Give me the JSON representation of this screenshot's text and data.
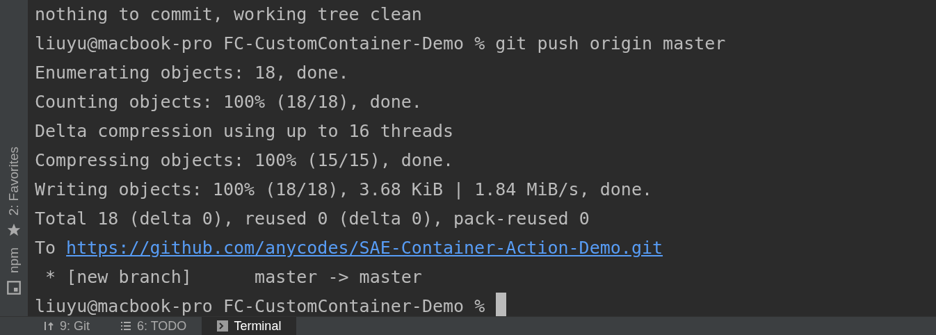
{
  "sidebar": {
    "items": [
      {
        "label": "2: Favorites",
        "kind": "star"
      },
      {
        "label": "npm",
        "kind": "square"
      }
    ]
  },
  "terminal": {
    "lines": [
      {
        "kind": "text",
        "text": "nothing to commit, working tree clean"
      },
      {
        "kind": "text",
        "text": "liuyu@macbook-pro FC-CustomContainer-Demo % git push origin master"
      },
      {
        "kind": "text",
        "text": "Enumerating objects: 18, done."
      },
      {
        "kind": "text",
        "text": "Counting objects: 100% (18/18), done."
      },
      {
        "kind": "text",
        "text": "Delta compression using up to 16 threads"
      },
      {
        "kind": "text",
        "text": "Compressing objects: 100% (15/15), done."
      },
      {
        "kind": "text",
        "text": "Writing objects: 100% (18/18), 3.68 KiB | 1.84 MiB/s, done."
      },
      {
        "kind": "text",
        "text": "Total 18 (delta 0), reused 0 (delta 0), pack-reused 0"
      },
      {
        "kind": "link",
        "text": "To",
        "link": "https://github.com/anycodes/SAE-Container-Action-Demo.git"
      },
      {
        "kind": "text",
        "text": " * [new branch]      master -> master"
      },
      {
        "kind": "prompt",
        "text": "liuyu@macbook-pro FC-CustomContainer-Demo %"
      }
    ]
  },
  "tabs": [
    {
      "label": "9: Git",
      "kind": "git",
      "selected": false
    },
    {
      "label": "6: TODO",
      "kind": "list",
      "selected": false
    },
    {
      "label": "Terminal",
      "kind": "terminal",
      "selected": true
    }
  ]
}
